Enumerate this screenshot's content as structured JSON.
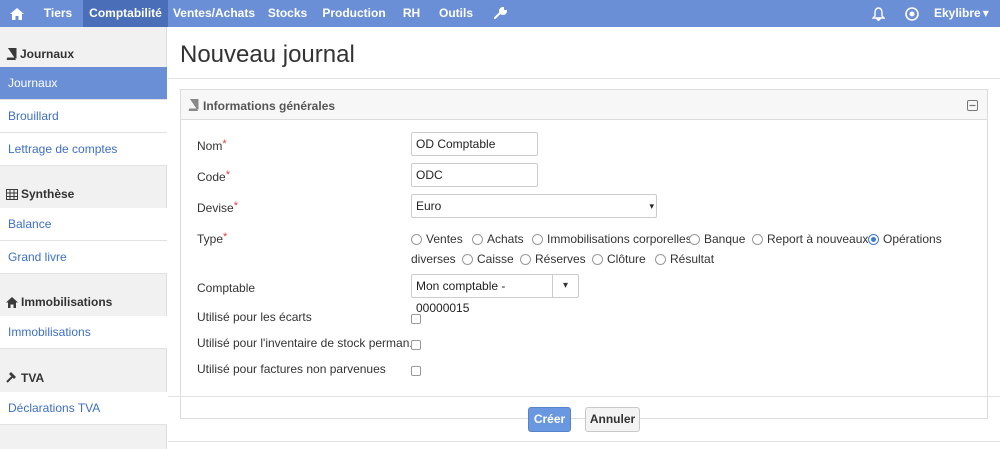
{
  "topnav": {
    "home_icon": "home-icon",
    "items": [
      "Tiers",
      "Comptabilité",
      "Ventes/Achats",
      "Stocks",
      "Production",
      "RH",
      "Outils"
    ],
    "active": "Comptabilité",
    "tools_icon": "wrench-icon",
    "bell_icon": "bell-icon",
    "globe_icon": "globe-icon",
    "user": "Ekylibre",
    "user_caret": "▾"
  },
  "sidebar": {
    "sections": [
      {
        "title": "Journaux",
        "icon": "book-icon",
        "items": [
          "Journaux",
          "Brouillard",
          "Lettrage de comptes"
        ]
      },
      {
        "title": "Synthèse",
        "icon": "table-icon",
        "items": [
          "Balance",
          "Grand livre"
        ]
      },
      {
        "title": "Immobilisations",
        "icon": "house-icon",
        "items": [
          "Immobilisations"
        ]
      },
      {
        "title": "TVA",
        "icon": "gavel-icon",
        "items": [
          "Déclarations TVA"
        ]
      }
    ],
    "active_item": "Journaux"
  },
  "page": {
    "title": "Nouveau journal"
  },
  "panel": {
    "title": "Informations générales",
    "collapse_icon": "minus-square-icon"
  },
  "form": {
    "nom": {
      "label": "Nom",
      "required": "*",
      "value": "OD Comptable"
    },
    "code": {
      "label": "Code",
      "required": "*",
      "value": "ODC"
    },
    "devise": {
      "label": "Devise",
      "required": "*",
      "value": "Euro",
      "caret": "▾"
    },
    "type": {
      "label": "Type",
      "required": "*",
      "options": [
        "Ventes",
        "Achats",
        "Immobilisations corporelles",
        "Banque",
        "Report à nouveaux",
        "Opérations",
        "diverses",
        "Caisse",
        "Réserves",
        "Clôture",
        "Résultat"
      ],
      "selected": "Opérations diverses"
    },
    "comptable": {
      "label": "Comptable",
      "value": "Mon comptable - 00000015",
      "caret": "▾"
    },
    "ecarts": {
      "label": "Utilisé pour les écarts",
      "checked": false
    },
    "inventaire": {
      "label": "Utilisé pour l'inventaire de stock perman...",
      "checked": false
    },
    "factures": {
      "label": "Utilisé pour factures non parvenues",
      "checked": false
    }
  },
  "actions": {
    "create": "Créer",
    "cancel": "Annuler"
  },
  "colors": {
    "nav": "#6a8fd6",
    "nav_active": "#4a6fb8",
    "primary": "#6a98e0",
    "link": "#3e6fc4"
  }
}
